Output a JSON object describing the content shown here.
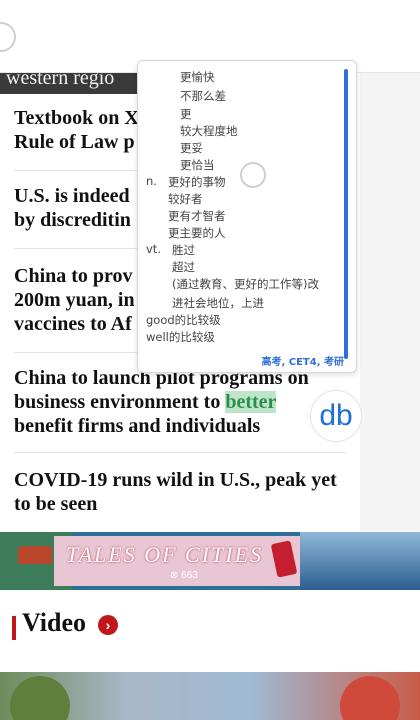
{
  "header": {
    "strip_text": "western regio"
  },
  "popup": {
    "lines": [
      "更愉快",
      "不那么差",
      "更",
      "较大程度地",
      "更妥",
      "更恰当",
      "更好的事物",
      "较好者",
      "更有才智者",
      "更主要的人",
      "胜过",
      "超过",
      "(通过教育、更好的工作等)改",
      "进社会地位，上进",
      "good的比较级",
      "well的比较级"
    ],
    "pos_n": "n.",
    "pos_vt": "vt.",
    "tags": "高考, CET4, 考研"
  },
  "news": [
    {
      "line1": "Textbook on X",
      "line2": "Rule of Law p"
    },
    {
      "line1": "U.S. is indeed",
      "line2": "by discreditin"
    },
    {
      "line1": "China to prov",
      "line2": "200m yuan, in",
      "line3": "vaccines to Af"
    },
    {
      "line1": "China to launch pilot programs on",
      "line2a": "business environment to ",
      "highlight": "better",
      "line3": "benefit firms and individuals"
    },
    {
      "line1": "COVID-19 runs wild in U.S., peak yet",
      "line2": "to be seen"
    }
  ],
  "banner": {
    "title": "TALES OF CITIES",
    "logo": "⊗ 663"
  },
  "section": {
    "video_label": "Video",
    "more_glyph": "›"
  },
  "dict_button": {
    "label": "db"
  },
  "colors": {
    "accent_red": "#c0171e",
    "dict_blue": "#1e6fd6",
    "highlight_bg": "#bfe5c9"
  }
}
